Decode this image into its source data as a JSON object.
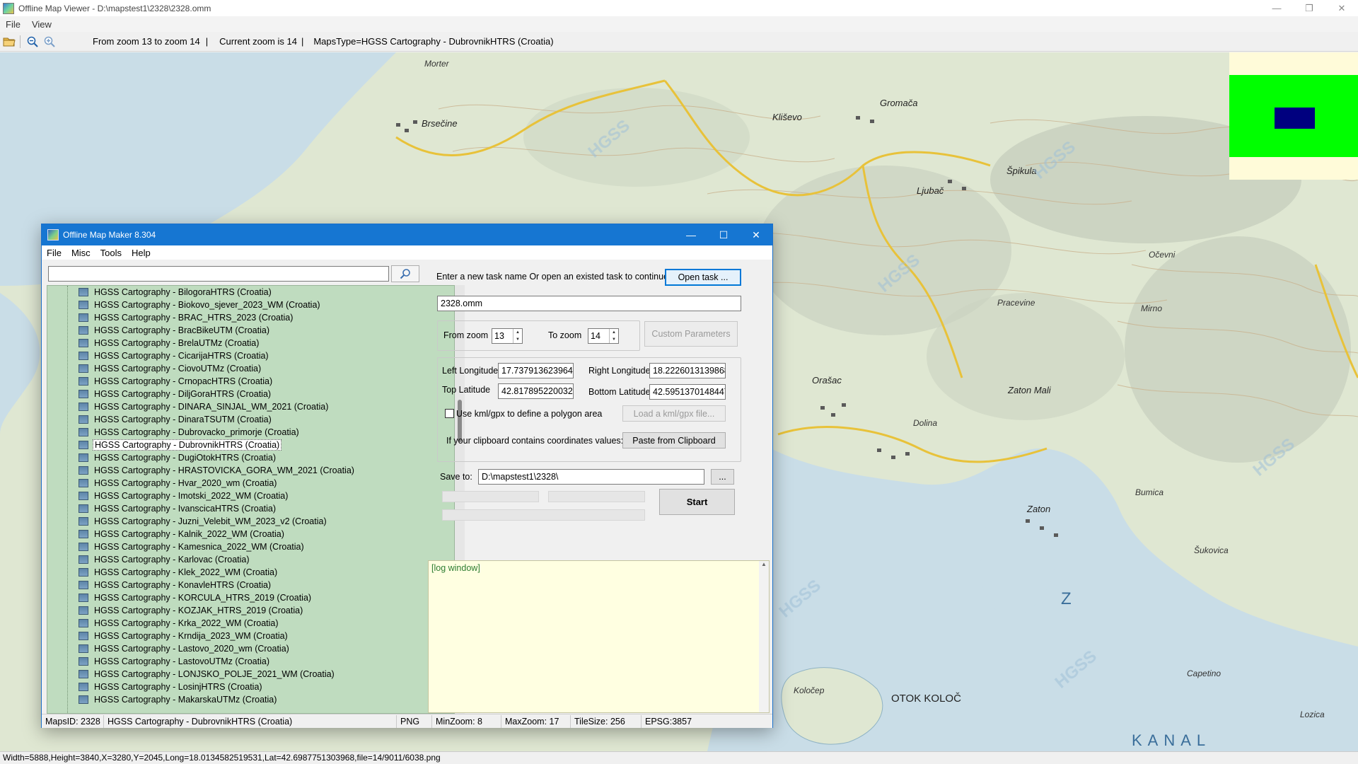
{
  "viewer": {
    "title": "Offline Map Viewer - D:\\mapstest1\\2328\\2328.omm",
    "menu": [
      "File",
      "View"
    ],
    "toolbar": {
      "zoom_range": "From zoom 13 to zoom 14",
      "current_zoom": "Current zoom is 14",
      "maps_type": "MapsType=HGSS Cartography - DubrovnikHTRS (Croatia)"
    },
    "status": "Width=5888,Height=3840,X=3280,Y=2045,Long=18.0134582519531,Lat=42.6987751303968,file=14/9011/6038.png"
  },
  "map_labels": {
    "morter": "Morter",
    "brsecine": "Brsečine",
    "klisevo": "Kliševo",
    "gromaca": "Gromača",
    "ljubac": "Ljubač",
    "spikula": "Špikula",
    "pracevine": "Pracevine",
    "orasac": "Orašac",
    "zaton_mali": "Zaton Mali",
    "zaton": "Zaton",
    "dolina": "Dolina",
    "ocevni": "Očevni",
    "mirno": "Mirno",
    "bumica": "Bumica",
    "sukovica": "Šukovica",
    "otok_kolocep": "OTOK KOLOČ",
    "kolocep": "Koločep",
    "lozica": "Lozica",
    "capetino": "Capetino",
    "kanal": "KANAL",
    "z": "Z",
    "hgss": "HGSS"
  },
  "dialog": {
    "title": "Offline Map Maker 8.304",
    "menu": [
      "File",
      "Misc",
      "Tools",
      "Help"
    ],
    "search_value": "",
    "maps": [
      "HGSS Cartography - BilogoraHTRS (Croatia)",
      "HGSS Cartography - Biokovo_sjever_2023_WM (Croatia)",
      "HGSS Cartography - BRAC_HTRS_2023 (Croatia)",
      "HGSS Cartography - BracBikeUTM (Croatia)",
      "HGSS Cartography - BrelaUTMz (Croatia)",
      "HGSS Cartography - CicarijaHTRS (Croatia)",
      "HGSS Cartography - CiovoUTMz (Croatia)",
      "HGSS Cartography - CrnopacHTRS (Croatia)",
      "HGSS Cartography - DiljGoraHTRS (Croatia)",
      "HGSS Cartography - DINARA_SINJAL_WM_2021 (Croatia)",
      "HGSS Cartography - DinaraTSUTM (Croatia)",
      "HGSS Cartography - Dubrovacko_primorje (Croatia)",
      "HGSS Cartography - DubrovnikHTRS (Croatia)",
      "HGSS Cartography - DugiOtokHTRS (Croatia)",
      "HGSS Cartography - HRASTOVICKA_GORA_WM_2021 (Croatia)",
      "HGSS Cartography - Hvar_2020_wm (Croatia)",
      "HGSS Cartography - Imotski_2022_WM (Croatia)",
      "HGSS Cartography - IvanscicaHTRS (Croatia)",
      "HGSS Cartography - Juzni_Velebit_WM_2023_v2 (Croatia)",
      "HGSS Cartography - Kalnik_2022_WM (Croatia)",
      "HGSS Cartography - Kamesnica_2022_WM (Croatia)",
      "HGSS Cartography - Karlovac (Croatia)",
      "HGSS Cartography - Klek_2022_WM (Croatia)",
      "HGSS Cartography - KonavleHTRS (Croatia)",
      "HGSS Cartography - KORCULA_HTRS_2019 (Croatia)",
      "HGSS Cartography - KOZJAK_HTRS_2019 (Croatia)",
      "HGSS Cartography - Krka_2022_WM (Croatia)",
      "HGSS Cartography - Krndija_2023_WM (Croatia)",
      "HGSS Cartography - Lastovo_2020_wm (Croatia)",
      "HGSS Cartography - LastovoUTMz (Croatia)",
      "HGSS Cartography - LONJSKO_POLJE_2021_WM (Croatia)",
      "HGSS Cartography - LosinjHTRS (Croatia)",
      "HGSS Cartography - MakarskaUTMz (Croatia)"
    ],
    "selected_map": "HGSS Cartography - DubrovnikHTRS (Croatia)",
    "task_prompt": "Enter a new task name Or open an existed task to continue:",
    "open_task_label": "Open task ...",
    "task_name": "2328.omm",
    "from_zoom_label": "From zoom",
    "from_zoom": "13",
    "to_zoom_label": "To zoom",
    "to_zoom": "14",
    "custom_params_label": "Custom Parameters",
    "left_lon_label": "Left Longitude",
    "left_lon": "17.7379136239647",
    "right_lon_label": "Right Longitude",
    "right_lon": "18.2226013139868",
    "top_lat_label": "Top Latitude",
    "top_lat": "42.8178952200321",
    "bottom_lat_label": "Bottom Latitude",
    "bottom_lat": "42.5951370148447",
    "kml_label": "Use kml/gpx to define a polygon area",
    "load_kml_label": "Load a kml/gpx file...",
    "clipboard_prompt": "If your clipboard contains coordinates values:",
    "paste_label": "Paste from Clipboard",
    "save_to_label": "Save to:",
    "save_to": "D:\\mapstest1\\2328\\",
    "browse_label": "...",
    "start_label": "Start",
    "log_text": "[log window]",
    "status": {
      "maps_id": "MapsID: 2328",
      "maps_name": "HGSS Cartography - DubrovnikHTRS (Croatia)",
      "format": "PNG",
      "min_zoom": "MinZoom: 8",
      "max_zoom": "MaxZoom: 17",
      "tile_size": "TileSize: 256",
      "epsg": "EPSG:3857"
    }
  },
  "colors": {
    "titlebar_accent": "#1676d2",
    "list_bg": "#bfdcbf",
    "log_bg": "#ffffe1",
    "overview_green": "#00ff00",
    "overview_blue": "#00007f"
  }
}
